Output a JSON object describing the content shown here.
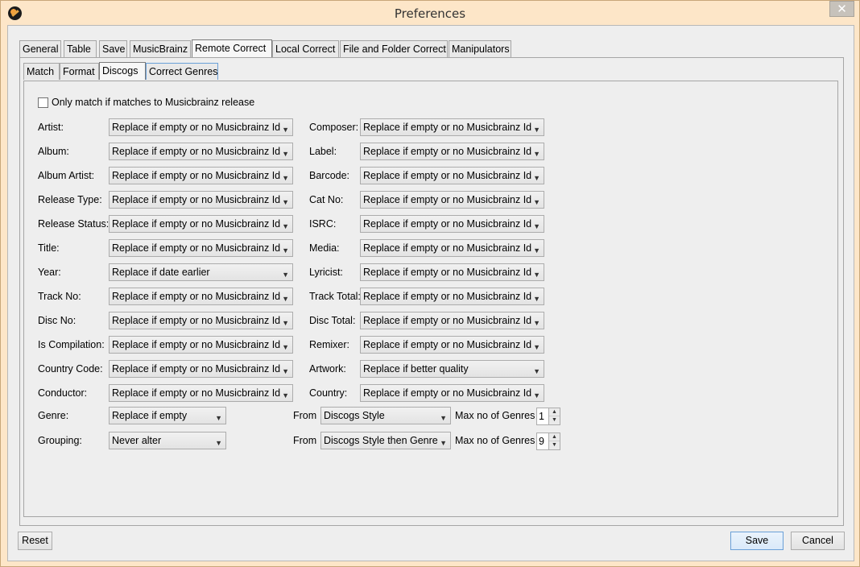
{
  "window": {
    "title": "Preferences",
    "close_label": "✕"
  },
  "outer_tabs": [
    "General",
    "Table",
    "Save",
    "MusicBrainz",
    "Remote Correct",
    "Local Correct",
    "File and Folder Correct",
    "Manipulators"
  ],
  "inner_tabs": [
    "Match",
    "Format",
    "Discogs",
    "Correct Genres"
  ],
  "only_match_label": "Only match if matches to Musicbrainz release",
  "left_fields": [
    {
      "label": "Artist:",
      "value": "Replace if empty or no Musicbrainz Id"
    },
    {
      "label": "Album:",
      "value": "Replace if empty or no Musicbrainz Id"
    },
    {
      "label": "Album Artist:",
      "value": "Replace if empty or no Musicbrainz Id"
    },
    {
      "label": "Release Type:",
      "value": "Replace if empty or no Musicbrainz Id"
    },
    {
      "label": "Release Status:",
      "value": "Replace if empty or no Musicbrainz Id"
    },
    {
      "label": "Title:",
      "value": "Replace if empty or no Musicbrainz Id"
    },
    {
      "label": "Year:",
      "value": "Replace if date earlier"
    },
    {
      "label": "Track No:",
      "value": "Replace if empty or no Musicbrainz Id"
    },
    {
      "label": "Disc No:",
      "value": "Replace if empty or no Musicbrainz Id"
    },
    {
      "label": "Is Compilation:",
      "value": "Replace if empty or no Musicbrainz Id"
    },
    {
      "label": "Country Code:",
      "value": "Replace if empty or no Musicbrainz Id"
    },
    {
      "label": "Conductor:",
      "value": "Replace if empty or no Musicbrainz Id"
    }
  ],
  "right_fields": [
    {
      "label": "Composer:",
      "value": "Replace if empty or no Musicbrainz Id"
    },
    {
      "label": "Label:",
      "value": "Replace if empty or no Musicbrainz Id"
    },
    {
      "label": "Barcode:",
      "value": "Replace if empty or no Musicbrainz Id"
    },
    {
      "label": "Cat No:",
      "value": "Replace if empty or no Musicbrainz Id"
    },
    {
      "label": "ISRC:",
      "value": "Replace if empty or no Musicbrainz Id"
    },
    {
      "label": "Media:",
      "value": "Replace if empty or no Musicbrainz Id"
    },
    {
      "label": "Lyricist:",
      "value": "Replace if empty or no Musicbrainz Id"
    },
    {
      "label": "Track Total:",
      "value": "Replace if empty or no Musicbrainz Id"
    },
    {
      "label": "Disc Total:",
      "value": "Replace if empty or no Musicbrainz Id"
    },
    {
      "label": "Remixer:",
      "value": "Replace if empty or no Musicbrainz Id"
    },
    {
      "label": "Artwork:",
      "value": "Replace if better quality"
    },
    {
      "label": "Country:",
      "value": "Replace if empty or no Musicbrainz Id"
    }
  ],
  "genre": {
    "label": "Genre:",
    "value": "Replace if empty",
    "from_label": "From",
    "from_value": "Discogs Style",
    "max_label": "Max no of Genres",
    "max_value": "1"
  },
  "grouping": {
    "label": "Grouping:",
    "value": "Never alter",
    "from_label": "From",
    "from_value": "Discogs Style then Genre",
    "max_label": "Max no of Genres",
    "max_value": "9"
  },
  "buttons": {
    "reset": "Reset",
    "save": "Save",
    "cancel": "Cancel"
  },
  "icons": {
    "dropdown": "▼",
    "spin_up": "▲",
    "spin_down": "▼"
  }
}
